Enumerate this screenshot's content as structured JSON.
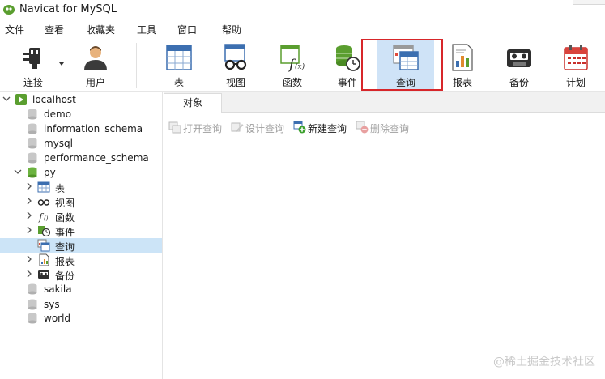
{
  "window": {
    "title": "Navicat for MySQL"
  },
  "menu": [
    {
      "label": "文件"
    },
    {
      "label": "查看"
    },
    {
      "label": "收藏夹"
    },
    {
      "label": "工具"
    },
    {
      "label": "窗口"
    },
    {
      "label": "帮助"
    }
  ],
  "toolbar": {
    "connect": "连接",
    "user": "用户",
    "table": "表",
    "view": "视图",
    "function": "函数",
    "event": "事件",
    "query": "查询",
    "report": "报表",
    "backup": "备份",
    "schedule": "计划"
  },
  "tree": {
    "connection": "localhost",
    "databases": [
      "demo",
      "information_schema",
      "mysql",
      "performance_schema"
    ],
    "open_db": "py",
    "objects": [
      "表",
      "视图",
      "函数",
      "事件",
      "查询",
      "报表",
      "备份"
    ],
    "more_databases": [
      "sakila",
      "sys",
      "world"
    ]
  },
  "tabs": {
    "objects": "对象"
  },
  "object_toolbar": {
    "open_query": "打开查询",
    "design_query": "设计查询",
    "new_query": "新建查询",
    "delete_query": "删除查询"
  },
  "watermark": "@稀土掘金技术社区",
  "colors": {
    "accent_red": "#d7262a",
    "selection": "#cfe3f7",
    "navicat_green": "#5a9e2f"
  }
}
